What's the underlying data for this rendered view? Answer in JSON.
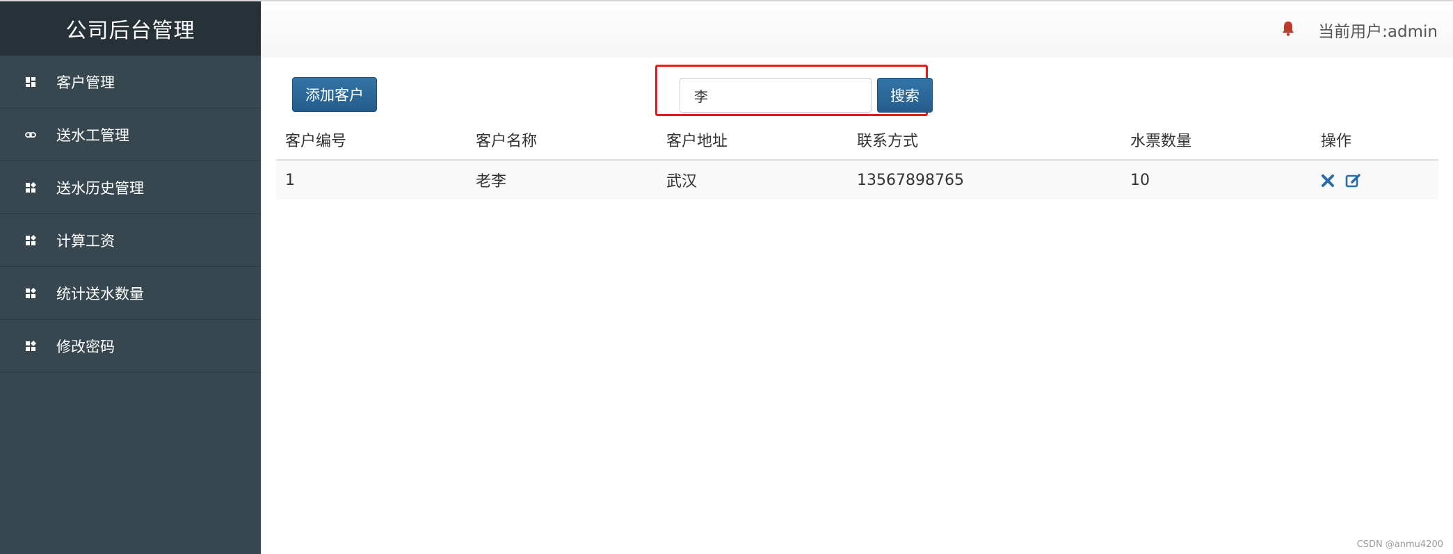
{
  "app": {
    "title": "公司后台管理"
  },
  "sidebar": {
    "items": [
      {
        "label": "客户管理",
        "icon": "dashboard-icon"
      },
      {
        "label": "送水工管理",
        "icon": "link-icon"
      },
      {
        "label": "送水历史管理",
        "icon": "dashboard-icon"
      },
      {
        "label": "计算工资",
        "icon": "dashboard-icon"
      },
      {
        "label": "统计送水数量",
        "icon": "dashboard-icon"
      },
      {
        "label": "修改密码",
        "icon": "dashboard-icon"
      }
    ]
  },
  "header": {
    "current_user": "当前用户:admin",
    "bell_icon": "bell-icon"
  },
  "toolbar": {
    "add_label": "添加客户",
    "search_value": "李",
    "search_label": "搜索"
  },
  "table": {
    "headers": [
      "客户编号",
      "客户名称",
      "客户地址",
      "联系方式",
      "水票数量",
      "操作"
    ],
    "rows": [
      [
        "1",
        "老李",
        "武汉",
        "13567898765",
        "10"
      ]
    ],
    "row_actions": [
      "delete-icon",
      "edit-icon"
    ]
  },
  "colors": {
    "sidebar_bg": "#37474f",
    "brand_bg": "#263238",
    "primary_button": "#2d6a9c",
    "highlight_border": "#e21b1b",
    "bell": "#c0392b",
    "action_icon": "#2a6ca8"
  },
  "watermark": "CSDN @anmu4200"
}
